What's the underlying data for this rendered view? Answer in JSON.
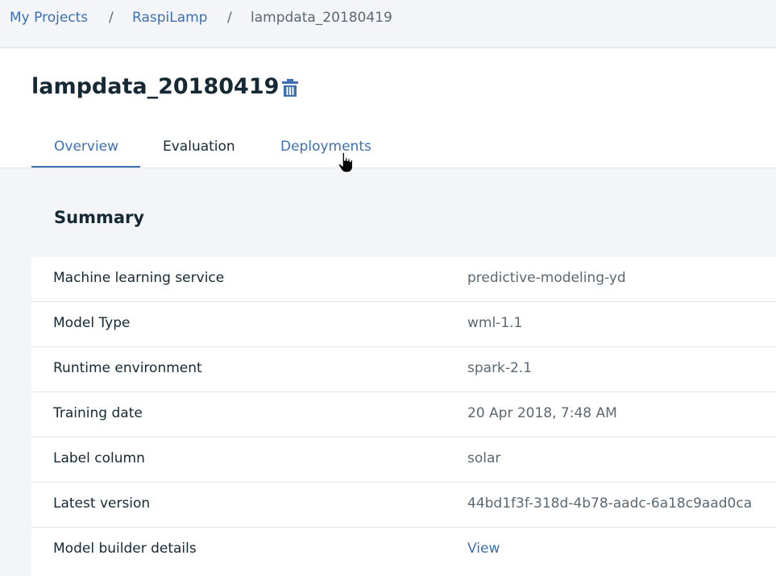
{
  "breadcrumb": {
    "items": [
      "My Projects",
      "RaspiLamp",
      "lampdata_20180419"
    ],
    "separator": "/"
  },
  "header": {
    "title": "lampdata_20180419",
    "delete_icon": "trash-icon"
  },
  "tabs": [
    {
      "label": "Overview",
      "active": true
    },
    {
      "label": "Evaluation",
      "active": false
    },
    {
      "label": "Deployments",
      "active": false
    }
  ],
  "summary": {
    "title": "Summary",
    "rows": [
      {
        "label": "Machine learning service",
        "value": "predictive-modeling-yd"
      },
      {
        "label": "Model Type",
        "value": "wml-1.1"
      },
      {
        "label": "Runtime environment",
        "value": "spark-2.1"
      },
      {
        "label": "Training date",
        "value": "20 Apr 2018, 7:48 AM"
      },
      {
        "label": "Label column",
        "value": "solar"
      },
      {
        "label": "Latest version",
        "value": "44bd1f3f-318d-4b78-aadc-6a18c9aad0ca"
      },
      {
        "label": "Model builder details",
        "value": "View"
      }
    ]
  },
  "colors": {
    "accent": "#3d70b2",
    "text_primary": "#152935",
    "text_secondary": "#5a6872",
    "page_background": "#f4f5f9"
  }
}
